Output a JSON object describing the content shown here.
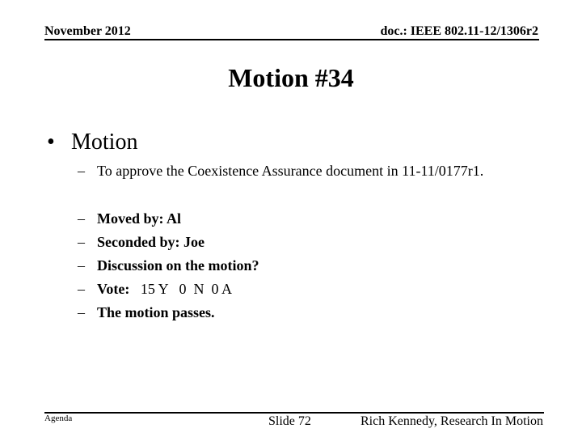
{
  "header": {
    "date": "November 2012",
    "doc_id": "doc.: IEEE 802.11-12/1306r2"
  },
  "title": "Motion #34",
  "bullet": {
    "label": "Motion",
    "sub_items": [
      "To approve the Coexistence Assurance document in 11-11/0177r1."
    ]
  },
  "details": [
    {
      "label": "Moved by: Al"
    },
    {
      "label": "Seconded by: Joe"
    },
    {
      "label": "Discussion on the motion?"
    },
    {
      "label": "Vote:",
      "value": "   15 Y   0  N  0 A"
    },
    {
      "label": "The motion passes."
    }
  ],
  "footer": {
    "left": "Agenda",
    "slide": "Slide 72",
    "author": "Rich Kennedy, Research In Motion"
  }
}
